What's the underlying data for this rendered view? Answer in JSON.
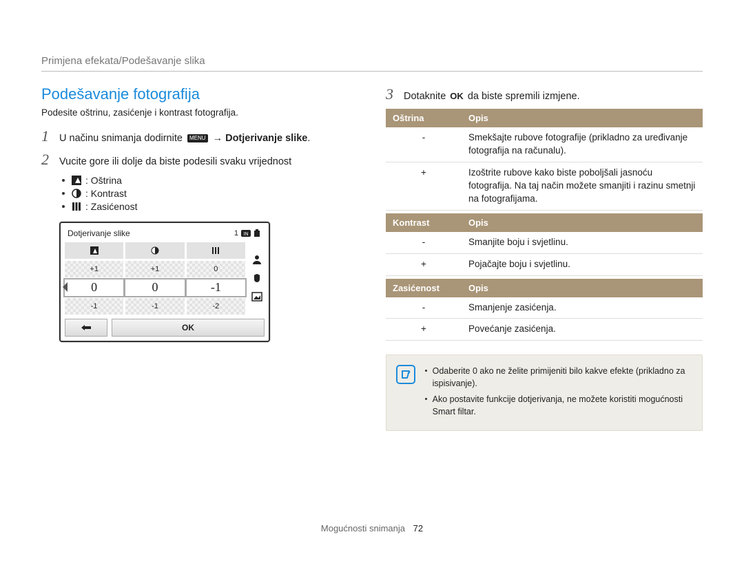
{
  "breadcrumb": "Primjena efekata/Podešavanje slika",
  "heading": "Podešavanje fotografija",
  "description": "Podesite oštrinu, zasićenje i kontrast fotografija.",
  "steps": {
    "s1": {
      "num": "1",
      "pre": "U načinu snimanja dodirnite ",
      "menu": "MENU",
      "arrow": "→",
      "bold": "Dotjerivanje slike",
      "dot": "."
    },
    "s2": {
      "num": "2",
      "txt": "Vucite gore ili dolje da biste podesili svaku vrijednost"
    },
    "s3": {
      "num": "3",
      "pre": "Dotaknite ",
      "ok": "OK",
      "post": " da biste spremili izmjene."
    }
  },
  "sublist": {
    "ostrina": ": Oštrina",
    "kontrast": ": Kontrast",
    "zasicenost": ": Zasićenost"
  },
  "preview": {
    "title": "Dotjerivanje slike",
    "count": "1",
    "ok": "OK",
    "row1": [
      "+1",
      "+1",
      "0"
    ],
    "row_sel": [
      "0",
      "0",
      "-1"
    ],
    "row3": [
      "-1",
      "-1",
      "-2"
    ]
  },
  "tables": {
    "ostrina": {
      "head1": "Oštrina",
      "head2": "Opis",
      "rows": [
        {
          "sym": "-",
          "desc": "Smekšajte rubove fotografije (prikladno za uređivanje fotografija na računalu)."
        },
        {
          "sym": "+",
          "desc": "Izoštrite rubove kako biste poboljšali jasnoću fotografija. Na taj način možete smanjiti i razinu smetnji na fotografijama."
        }
      ]
    },
    "kontrast": {
      "head1": "Kontrast",
      "head2": "Opis",
      "rows": [
        {
          "sym": "-",
          "desc": "Smanjite boju i svjetlinu."
        },
        {
          "sym": "+",
          "desc": "Pojačajte boju i svjetlinu."
        }
      ]
    },
    "zasicenost": {
      "head1": "Zasićenost",
      "head2": "Opis",
      "rows": [
        {
          "sym": "-",
          "desc": "Smanjenje zasićenja."
        },
        {
          "sym": "+",
          "desc": "Povećanje zasićenja."
        }
      ]
    }
  },
  "note": {
    "li1": "Odaberite 0 ako ne želite primijeniti bilo kakve efekte (prikladno za ispisivanje).",
    "li2": "Ako postavite funkcije dotjerivanja, ne možete koristiti mogućnosti Smart filtar."
  },
  "footer": {
    "section": "Mogućnosti snimanja",
    "page": "72"
  }
}
